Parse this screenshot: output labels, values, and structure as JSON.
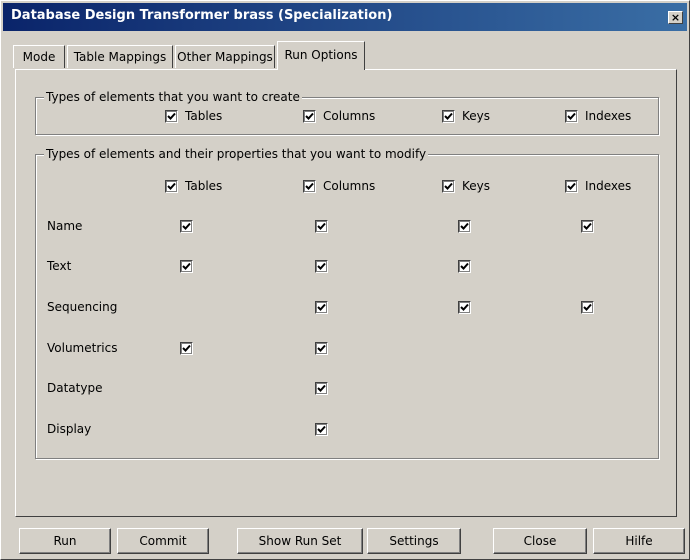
{
  "window": {
    "title": "Database Design Transformer brass (Specialization)",
    "close": "×"
  },
  "tabs": [
    {
      "label": "Mode"
    },
    {
      "label": "Table Mappings"
    },
    {
      "label": "Other Mappings"
    },
    {
      "label": "Run Options"
    }
  ],
  "create_group": {
    "title": "Types of elements that you want to create",
    "options": [
      {
        "label": "Tables",
        "checked": true
      },
      {
        "label": "Columns",
        "checked": true
      },
      {
        "label": "Keys",
        "checked": true
      },
      {
        "label": "Indexes",
        "checked": true
      }
    ]
  },
  "modify_group": {
    "title": "Types of elements and their properties that you want to modify",
    "headers": [
      {
        "label": "Tables",
        "checked": true
      },
      {
        "label": "Columns",
        "checked": true
      },
      {
        "label": "Keys",
        "checked": true
      },
      {
        "label": "Indexes",
        "checked": true
      }
    ],
    "rows": [
      {
        "label": "Name",
        "tables": true,
        "columns": true,
        "keys": true,
        "indexes": true
      },
      {
        "label": "Text",
        "tables": true,
        "columns": true,
        "keys": true,
        "indexes": null
      },
      {
        "label": "Sequencing",
        "tables": null,
        "columns": true,
        "keys": true,
        "indexes": true
      },
      {
        "label": "Volumetrics",
        "tables": true,
        "columns": true,
        "keys": null,
        "indexes": null
      },
      {
        "label": "Datatype",
        "tables": null,
        "columns": true,
        "keys": null,
        "indexes": null
      },
      {
        "label": "Display",
        "tables": null,
        "columns": true,
        "keys": null,
        "indexes": null
      }
    ]
  },
  "buttons": {
    "run": "Run",
    "commit": "Commit",
    "show_run_set": "Show Run Set",
    "settings": "Settings",
    "close": "Close",
    "help": "Hilfe"
  }
}
